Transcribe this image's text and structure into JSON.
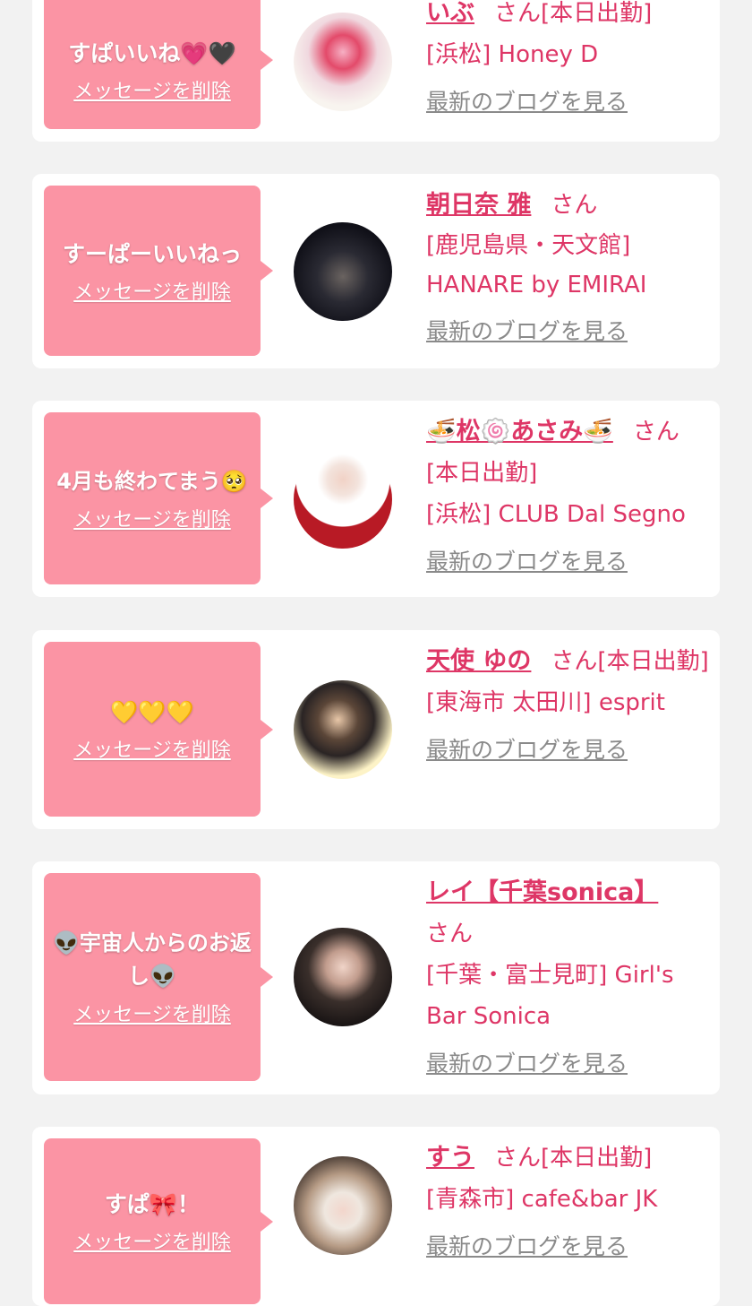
{
  "delete_label": "メッセージを削除",
  "blog_label": "最新のブログを見る",
  "san_label": "さん",
  "colors": {
    "accent": "#de3666",
    "bubble": "#fb94a4",
    "background": "#f2f2f2"
  },
  "cards": [
    {
      "message": "すぱいいね💗🖤",
      "name": "いぶ",
      "status": "[本日出勤]",
      "store": "[浜松] Honey D"
    },
    {
      "message": "すーぱーいいねっ",
      "name": "朝日奈 雅",
      "status": "",
      "store": "[鹿児島県・天文館] HANARE by EMIRAI"
    },
    {
      "message": "4月も終わてまう🥺",
      "name": "🍜松🍥あさみ🍜",
      "status": "[本日出勤]",
      "store": "[浜松] CLUB Dal Segno"
    },
    {
      "message": "💛💛💛",
      "name": "天使 ゆの",
      "status": "[本日出勤]",
      "store": "[東海市 太田川] esprit"
    },
    {
      "message": "👽宇宙人からのお返し👽",
      "name": "レイ【千葉sonica】",
      "status": "",
      "store": "[千葉・富士見町] Girl's Bar Sonica"
    },
    {
      "message": "すぱ🎀！",
      "name": "すう",
      "status": "[本日出勤]",
      "store": "[青森市] cafe&bar JK"
    }
  ]
}
